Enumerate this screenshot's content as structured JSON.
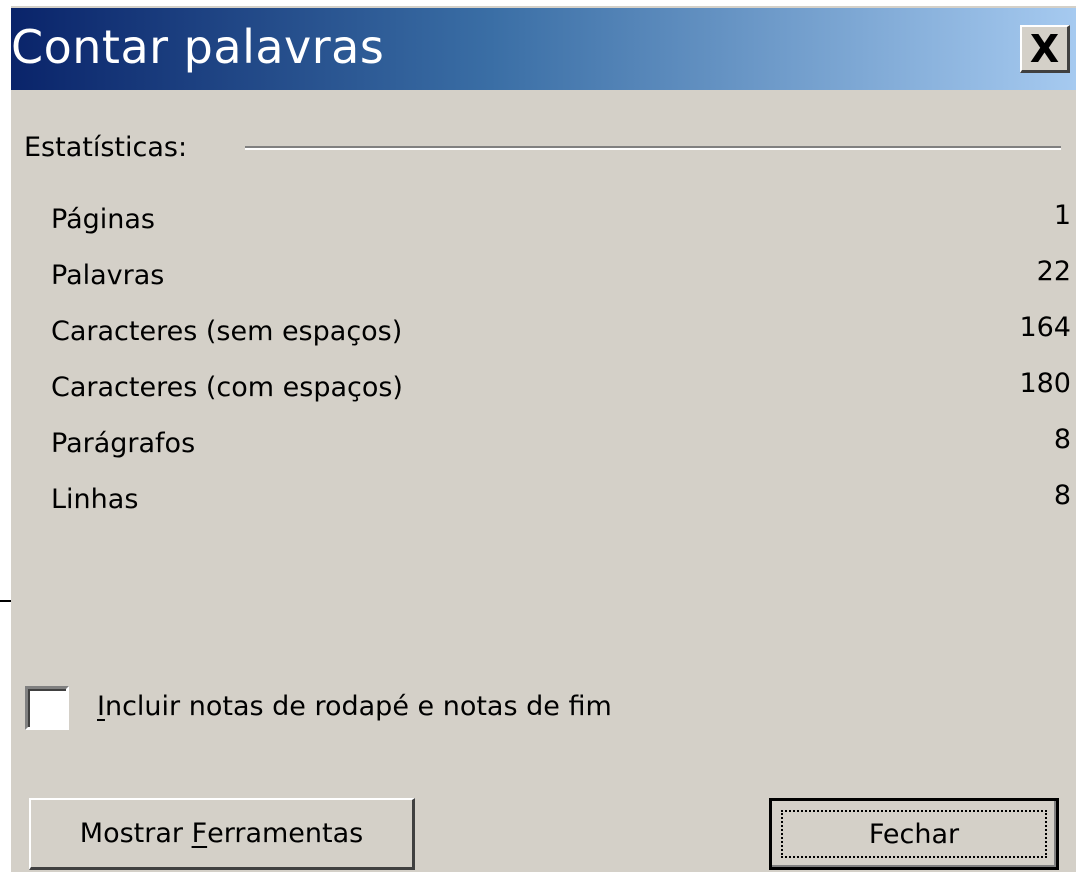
{
  "window": {
    "title": "Contar palavras",
    "close_label": "X"
  },
  "statistics": {
    "label": "Estatísticas:",
    "rows": [
      {
        "label": "Páginas",
        "value": "1"
      },
      {
        "label": "Palavras",
        "value": "22"
      },
      {
        "label": "Caracteres (sem espaços)",
        "value": "164"
      },
      {
        "label": "Caracteres (com espaços)",
        "value": "180"
      },
      {
        "label": "Parágrafos",
        "value": "8"
      },
      {
        "label": "Linhas",
        "value": "8"
      }
    ]
  },
  "include_notes": {
    "mnemonic": "I",
    "label_rest": "ncluir notas de rodapé e notas de fim",
    "checked": false
  },
  "buttons": {
    "tools_prefix": "Mostrar ",
    "tools_mnemonic": "F",
    "tools_rest": "erramentas",
    "close": "Fechar"
  },
  "colors": {
    "dialog_face": "#d4d0c8",
    "title_gradient_start": "#0a246a",
    "title_gradient_end": "#a6caf0"
  }
}
